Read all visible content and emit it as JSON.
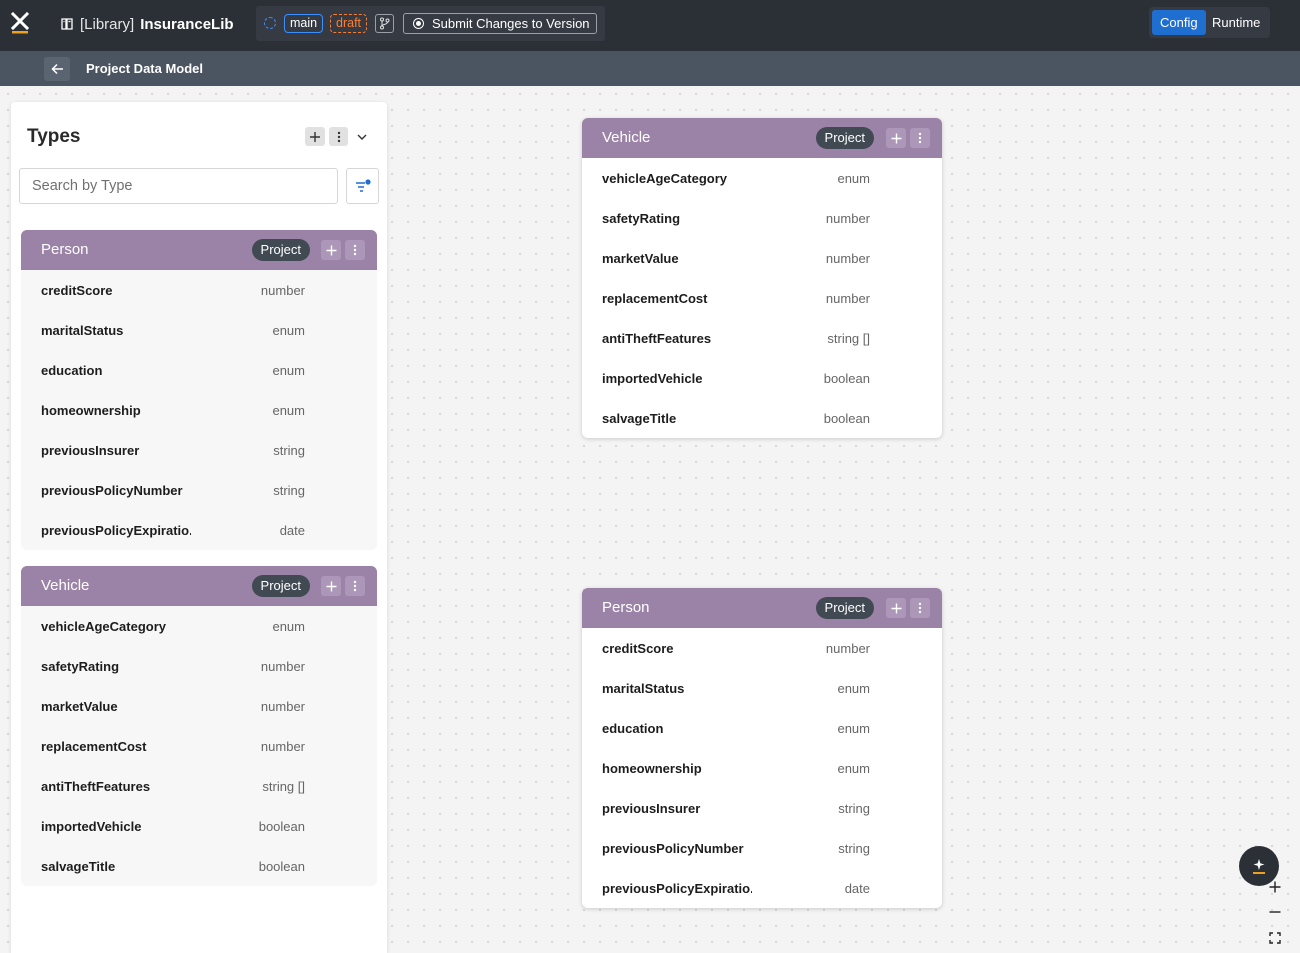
{
  "header": {
    "library_prefix": "[Library]",
    "library_name": "InsuranceLib",
    "branch": "main",
    "state": "draft",
    "submit_label": "Submit Changes to Version",
    "modes": [
      "Config",
      "Runtime"
    ],
    "active_mode": "Config"
  },
  "subheader": {
    "title": "Project Data Model"
  },
  "types_panel": {
    "title": "Types",
    "search_placeholder": "Search by Type",
    "cards": [
      {
        "title": "Person",
        "badge": "Project",
        "fields": [
          {
            "name": "creditScore",
            "type": "number"
          },
          {
            "name": "maritalStatus",
            "type": "enum"
          },
          {
            "name": "education",
            "type": "enum"
          },
          {
            "name": "homeownership",
            "type": "enum"
          },
          {
            "name": "previousInsurer",
            "type": "string"
          },
          {
            "name": "previousPolicyNumber",
            "type": "string"
          },
          {
            "name": "previousPolicyExpiratio...",
            "type": "date"
          }
        ]
      },
      {
        "title": "Vehicle",
        "badge": "Project",
        "fields": [
          {
            "name": "vehicleAgeCategory",
            "type": "enum"
          },
          {
            "name": "safetyRating",
            "type": "number"
          },
          {
            "name": "marketValue",
            "type": "number"
          },
          {
            "name": "replacementCost",
            "type": "number"
          },
          {
            "name": "antiTheftFeatures",
            "type": "string []"
          },
          {
            "name": "importedVehicle",
            "type": "boolean"
          },
          {
            "name": "salvageTitle",
            "type": "boolean"
          }
        ]
      }
    ]
  },
  "canvas": {
    "nodes": [
      {
        "title": "Vehicle",
        "badge": "Project",
        "fields": [
          {
            "name": "vehicleAgeCategory",
            "type": "enum"
          },
          {
            "name": "safetyRating",
            "type": "number"
          },
          {
            "name": "marketValue",
            "type": "number"
          },
          {
            "name": "replacementCost",
            "type": "number"
          },
          {
            "name": "antiTheftFeatures",
            "type": "string []"
          },
          {
            "name": "importedVehicle",
            "type": "boolean"
          },
          {
            "name": "salvageTitle",
            "type": "boolean"
          }
        ]
      },
      {
        "title": "Person",
        "badge": "Project",
        "fields": [
          {
            "name": "creditScore",
            "type": "number"
          },
          {
            "name": "maritalStatus",
            "type": "enum"
          },
          {
            "name": "education",
            "type": "enum"
          },
          {
            "name": "homeownership",
            "type": "enum"
          },
          {
            "name": "previousInsurer",
            "type": "string"
          },
          {
            "name": "previousPolicyNumber",
            "type": "string"
          },
          {
            "name": "previousPolicyExpiratio...",
            "type": "date"
          }
        ]
      }
    ]
  },
  "colors": {
    "topbar": "#2b2f36",
    "subbar": "#4b5561",
    "card_header": "#9b82a7",
    "accent_blue": "#1f6fd1",
    "draft_orange": "#ff7d2e"
  },
  "icons": {
    "logo": "x-logo-icon",
    "library": "book-icon",
    "status": "dashed-circle-icon",
    "branch": "git-branch-icon",
    "submit": "record-icon",
    "back": "arrow-left-icon",
    "add": "plus-icon",
    "more": "kebab-icon",
    "collapse": "chevron-down-icon",
    "filter": "filter-icon",
    "ai": "sparkle-icon",
    "zoom_in": "plus-icon",
    "zoom_out": "minus-icon",
    "fit": "fit-view-icon"
  }
}
